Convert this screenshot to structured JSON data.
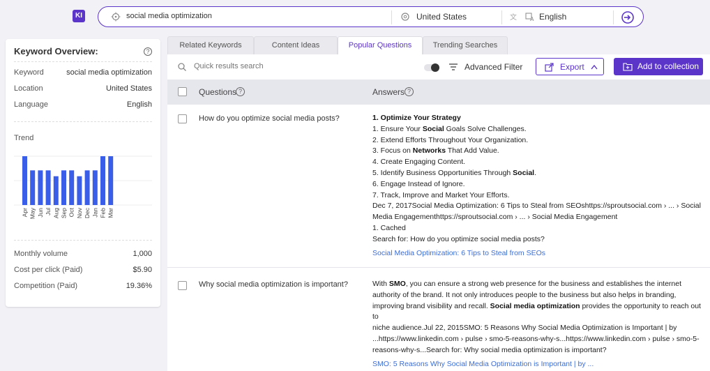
{
  "app": {
    "logo": "KI"
  },
  "search": {
    "query": "social media optimization",
    "location": "United States",
    "language": "English"
  },
  "overview": {
    "title": "Keyword Overview:",
    "keyword_label": "Keyword",
    "keyword": "social media optimization",
    "location_label": "Location",
    "location": "United States",
    "language_label": "Language",
    "language": "English",
    "trend_label": "Trend",
    "trend": {
      "months": [
        "Apr",
        "May",
        "Jun",
        "Jul",
        "Aug",
        "Sep",
        "Oct",
        "Nov",
        "Dec",
        "Jan",
        "Feb",
        "Mar"
      ],
      "levels": [
        1.0,
        0.71,
        0.71,
        0.71,
        0.59,
        0.71,
        0.71,
        0.59,
        0.71,
        0.71,
        1.0,
        1.0
      ],
      "color": "#3b5ee8"
    },
    "monthly_volume_label": "Monthly volume",
    "monthly_volume": "1,000",
    "cpc_label": "Cost per click (Paid)",
    "cpc": "$5.90",
    "competition_label": "Competition (Paid)",
    "competition": "19.36%"
  },
  "tabs": [
    "Related Keywords",
    "Content Ideas",
    "Popular Questions",
    "Trending Searches"
  ],
  "active_tab": 2,
  "toolbar": {
    "search_placeholder": "Quick results search",
    "advanced_filter": "Advanced Filter",
    "export": "Export",
    "add_to_collection": "Add to collection"
  },
  "table": {
    "col_questions": "Questions",
    "col_answers": "Answers",
    "rows": [
      {
        "question": "How do you optimize social media posts?",
        "answer_lines": [
          "1. Optimize Your Strategy",
          "1. Ensure Your Social Goals Solve Challenges.",
          "2. Extend Efforts Throughout Your Organization.",
          "3. Focus on Networks That Add Value.",
          "4. Create Engaging Content.",
          "5. Identify Business Opportunities Through Social.",
          "6. Engage Instead of Ignore.",
          "7. Track, Improve and Market Your Efforts.",
          "Dec 7, 2017Social Media Optimization: 6 Tips to Steal from SEOshttps://sproutsocial.com › ... › Social",
          "Media Engagementhttps://sproutsocial.com › ... › Social Media Engagement",
          "1. Cached",
          "Search for: How do you optimize social media posts?"
        ],
        "link": "Social Media Optimization: 6 Tips to Steal from SEOs"
      },
      {
        "question": "Why social media optimization is important?",
        "answer_lines": [
          "With SMO, you can ensure a strong web presence for the business and establishes the internet",
          "authority of the brand. It not only introduces people to the business but also helps in branding,",
          "improving brand visibility and recall. Social media optimization provides the opportunity to reach out to",
          "niche audience.Jul 22, 2015SMO: 5 Reasons Why Social Media Optimization is Important | by",
          "...https://www.linkedin.com › pulse › smo-5-reasons-why-s...https://www.linkedin.com › pulse › smo-5-",
          "reasons-why-s...Search for: Why social media optimization is important?"
        ],
        "link": "SMO: 5 Reasons Why Social Media Optimization is Important | by ..."
      }
    ]
  }
}
